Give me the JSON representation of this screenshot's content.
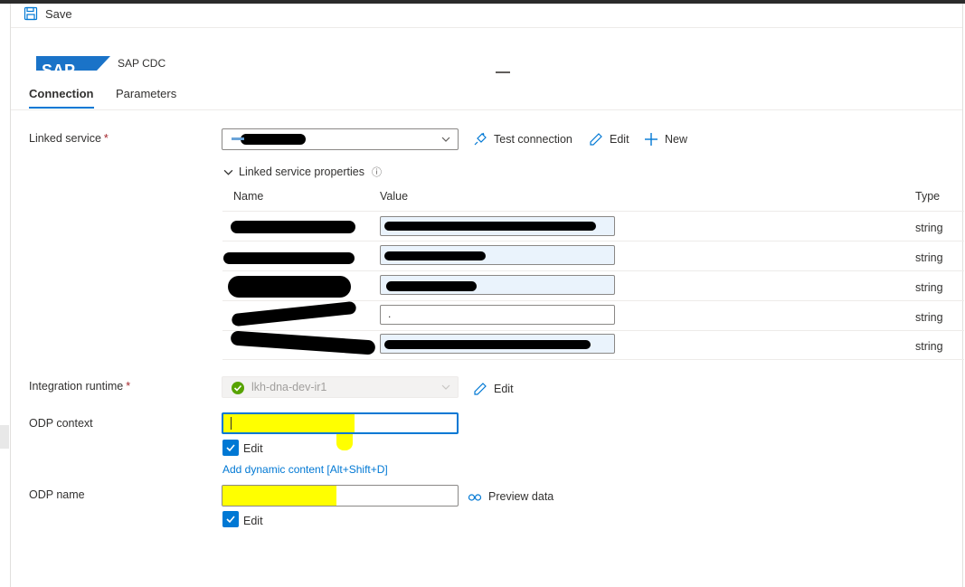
{
  "toolbar": {
    "save_label": "Save"
  },
  "header": {
    "title": "SAP CDC",
    "logo_text": "SAP"
  },
  "tabs": [
    {
      "label": "Connection",
      "active": true
    },
    {
      "label": "Parameters",
      "active": false
    }
  ],
  "linked_service": {
    "label": "Linked service",
    "required_mark": "*",
    "actions": {
      "test_connection": "Test connection",
      "edit": "Edit",
      "new": "New"
    },
    "properties_toggle": "Linked service properties",
    "columns": {
      "name": "Name",
      "value": "Value",
      "type": "Type"
    },
    "rows": [
      {
        "type": "string"
      },
      {
        "type": "string"
      },
      {
        "type": "string"
      },
      {
        "value": ".",
        "type": "string"
      },
      {
        "type": "string"
      }
    ]
  },
  "integration_runtime": {
    "label": "Integration runtime",
    "required_mark": "*",
    "value": "lkh-dna-dev-ir1",
    "edit": "Edit"
  },
  "odp_context": {
    "label": "ODP context",
    "edit_label": "Edit",
    "checked": true,
    "dynamic_content_link": "Add dynamic content [Alt+Shift+D]"
  },
  "odp_name": {
    "label": "ODP name",
    "preview": "Preview data",
    "edit_label": "Edit",
    "checked": true
  },
  "colors": {
    "accent": "#0078d4",
    "highlight": "#ffff00",
    "status_ok": "#57a300",
    "required": "#a4262c"
  }
}
